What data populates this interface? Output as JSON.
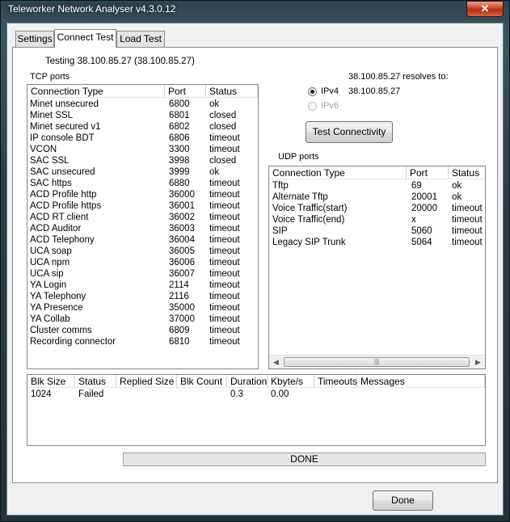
{
  "window": {
    "title": "Teleworker Network Analyser v4.3.0.12",
    "close_label": "✕"
  },
  "tabs": [
    {
      "label": "Settings"
    },
    {
      "label": "Connect Test"
    },
    {
      "label": "Load Test"
    }
  ],
  "testing_label": "Testing 38.100.85.27 (38.100.85.27)",
  "resolve": {
    "label": "38.100.85.27 resolves to:",
    "ipv4_label": "IPv4",
    "ipv4_value": "38.100.85.27",
    "ipv6_label": "IPv6"
  },
  "test_button": "Test Connectivity",
  "tcp": {
    "label": "TCP ports",
    "headers": [
      "Connection Type",
      "Port",
      "Status"
    ],
    "rows": [
      [
        "Minet unsecured",
        "6800",
        "ok"
      ],
      [
        "Minet SSL",
        "6801",
        "closed"
      ],
      [
        "Minet secured v1",
        "6802",
        "closed"
      ],
      [
        "IP console BDT",
        "6806",
        "timeout"
      ],
      [
        "VCON",
        "3300",
        "timeout"
      ],
      [
        "SAC SSL",
        "3998",
        "closed"
      ],
      [
        "SAC unsecured",
        "3999",
        "ok"
      ],
      [
        "SAC https",
        "6880",
        "timeout"
      ],
      [
        "ACD Profile http",
        "36000",
        "timeout"
      ],
      [
        "ACD Profile https",
        "36001",
        "timeout"
      ],
      [
        "ACD RT client",
        "36002",
        "timeout"
      ],
      [
        "ACD Auditor",
        "36003",
        "timeout"
      ],
      [
        "ACD Telephony",
        "36004",
        "timeout"
      ],
      [
        "UCA soap",
        "36005",
        "timeout"
      ],
      [
        "UCA npm",
        "36006",
        "timeout"
      ],
      [
        "UCA sip",
        "36007",
        "timeout"
      ],
      [
        "YA Login",
        "2114",
        "timeout"
      ],
      [
        "YA Telephony",
        "2116",
        "timeout"
      ],
      [
        "YA Presence",
        "35000",
        "timeout"
      ],
      [
        "YA Collab",
        "37000",
        "timeout"
      ],
      [
        "Cluster comms",
        "6809",
        "timeout"
      ],
      [
        "Recording connector",
        "6810",
        "timeout"
      ]
    ]
  },
  "udp": {
    "label": "UDP ports",
    "headers": [
      "Connection Type",
      "Port",
      "Status"
    ],
    "rows": [
      [
        "Tftp",
        "69",
        "ok"
      ],
      [
        "Alternate Tftp",
        "20001",
        "ok"
      ],
      [
        "Voice Traffic(start)",
        "20000",
        "timeout"
      ],
      [
        "Voice Traffic(end)",
        "x",
        "timeout"
      ],
      [
        "SIP",
        "5060",
        "timeout"
      ],
      [
        "Legacy SIP Trunk",
        "5064",
        "timeout"
      ]
    ]
  },
  "results": {
    "headers": [
      "Blk Size",
      "Status",
      "Replied Size",
      "Blk Count",
      "Duration",
      "Kbyte/s",
      "Timeouts",
      "Messages"
    ],
    "rows": [
      [
        "1024",
        "Failed",
        "",
        "",
        "0.3",
        "0.00",
        "",
        ""
      ]
    ]
  },
  "progress_text": "DONE",
  "done_button": "Done"
}
